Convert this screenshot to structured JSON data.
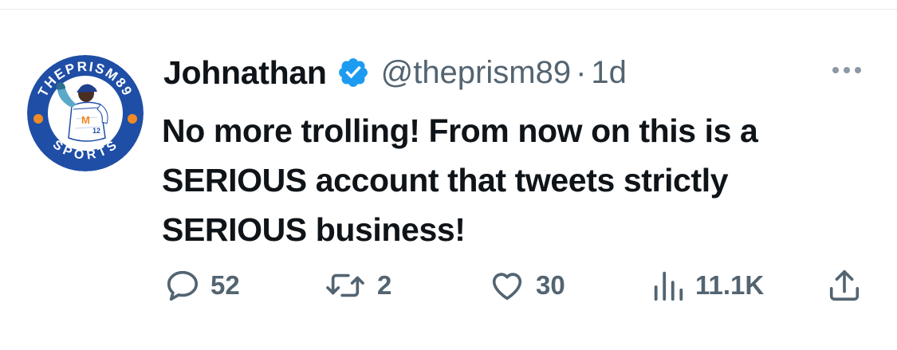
{
  "tweet": {
    "display_name": "Johnathan",
    "handle": "@theprism89",
    "separator": "·",
    "time": "1d",
    "verified": true,
    "avatar": {
      "ring_text_top": "THEPRISM89",
      "ring_text_bottom": "SPORTS"
    },
    "text_lines": [
      "No more trolling! From now on this is a",
      "SERIOUS account that tweets strictly",
      "SERIOUS business!"
    ],
    "actions": {
      "replies": "52",
      "retweets": "2",
      "likes": "30",
      "views": "11.1K"
    }
  },
  "colors": {
    "brand_blue": "#1d9bf0",
    "avatar_navy": "#1f4ea6",
    "avatar_orange": "#f08a24",
    "secondary_text": "#536471"
  },
  "icons": [
    "verified-badge-icon",
    "more-dots-icon",
    "reply-icon",
    "retweet-icon",
    "like-icon",
    "views-icon",
    "share-icon"
  ]
}
